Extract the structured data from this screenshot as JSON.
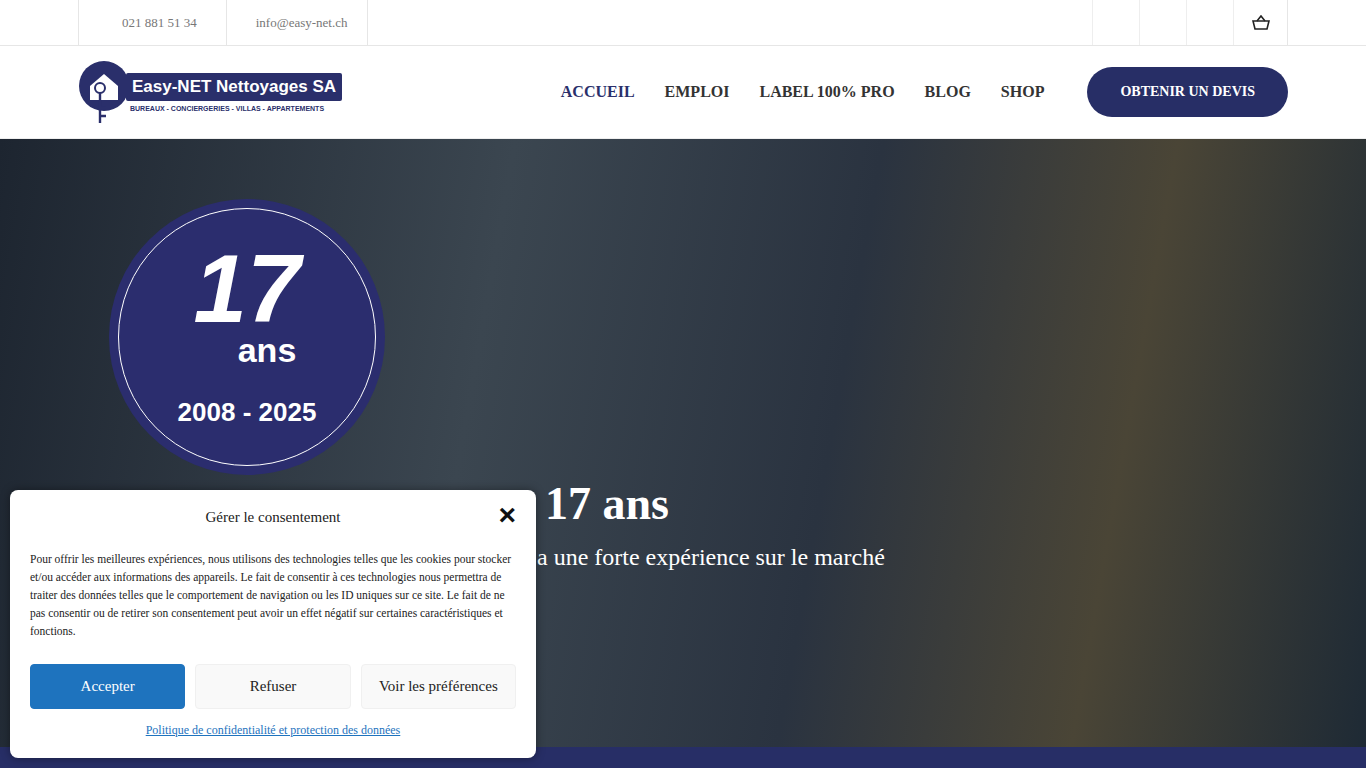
{
  "topbar": {
    "phone": "021 881 51 34",
    "email": "info@easy-net.ch",
    "social_cells": 3,
    "cart_icon": true
  },
  "logo": {
    "name": "Easy-NET Nettoyages SA",
    "tagline": "BUREAUX - CONCIERGERIES - VILLAS - APPARTEMENTS"
  },
  "nav": [
    {
      "label": "ACCUEIL",
      "selected": true
    },
    {
      "label": "EMPLOI",
      "selected": false
    },
    {
      "label": "LABEL 100% PRO",
      "selected": false
    },
    {
      "label": "BLOG",
      "selected": false
    },
    {
      "label": "SHOP",
      "selected": false
    }
  ],
  "cta": "OBTENIR UN DEVIS",
  "badge": {
    "number": "17",
    "unit": "ans",
    "years": "2008 - 2025"
  },
  "hero": {
    "title": "17 ans",
    "subtitle": "a une forte expérience sur le marché"
  },
  "consent": {
    "title": "Gérer le consentement",
    "close": "×",
    "text": "Pour offrir les meilleures expériences, nous utilisons des technologies telles que les cookies pour stocker et/ou accéder aux informations des appareils. Le fait de consentir à ces technologies nous permettra de traiter des données telles que le comportement de navigation ou les ID uniques sur ce site. Le fait de ne pas consentir ou de retirer son consentement peut avoir un effet négatif sur certaines caractéristiques et fonctions.",
    "buttons": [
      {
        "label": "Accepter",
        "kind": "primary"
      },
      {
        "label": "Refuser",
        "kind": "secondary"
      },
      {
        "label": "Voir les préférences",
        "kind": "secondary"
      }
    ],
    "link": "Politique de confidentialité et protection des données"
  }
}
